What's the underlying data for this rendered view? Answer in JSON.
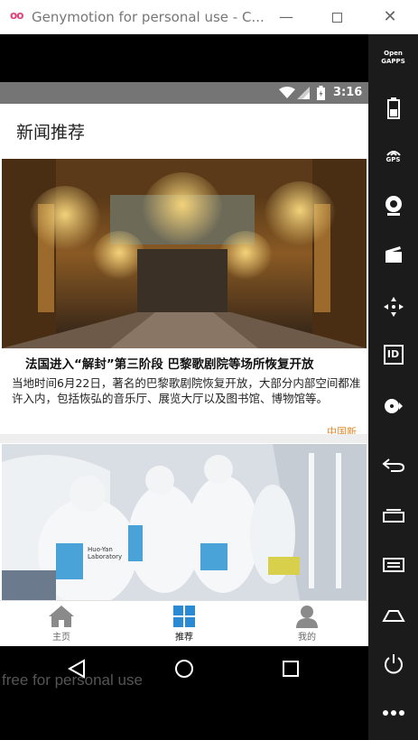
{
  "window": {
    "logo_text": "oo",
    "title": "Genymotion for personal use - C...",
    "watermark": "free for personal use"
  },
  "statusbar": {
    "time": "3:16"
  },
  "appbar": {
    "title": "新闻推荐"
  },
  "news": [
    {
      "headline": "法国进入“解封”第三阶段 巴黎歌剧院等场所恢复开放",
      "summary": "当地时间6月22日，著名的巴黎歌剧院恢复开放，大部分内部空间都准许入内，包括恢弘的音乐厅、展览大厅以及图书馆、博物馆等。",
      "source": "中国新",
      "image": "opera-hall-photo"
    },
    {
      "image": "medical-workers-photo",
      "jacket_text": "Huo-Yan Laboratory"
    }
  ],
  "bottom_nav": [
    {
      "label": "主页",
      "icon": "home-icon"
    },
    {
      "label": "推荐",
      "icon": "grid-icon",
      "active": true
    },
    {
      "label": "我的",
      "icon": "person-icon"
    }
  ],
  "right_panel": {
    "opengapps_label": "Open GAPPS",
    "gps_label": "GPS",
    "id_label": "ID"
  },
  "colors": {
    "accent": "#2a8ad4",
    "status_bar": "#757575",
    "source": "#e08a2c"
  }
}
